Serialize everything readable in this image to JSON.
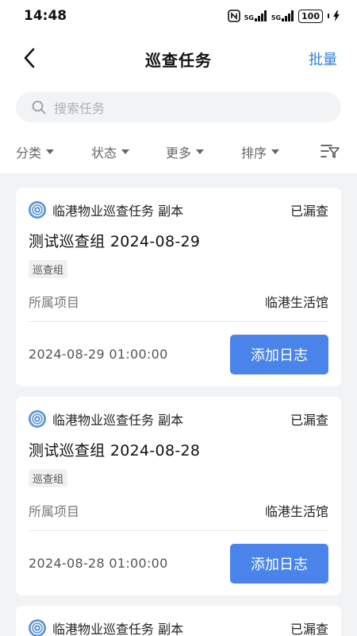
{
  "status_bar": {
    "time": "14:48",
    "signal_1": "5G",
    "signal_2": "5G",
    "battery": "100",
    "icons": [
      "nfc-icon",
      "signal-icon",
      "signal-icon",
      "battery-icon",
      "charging-icon"
    ]
  },
  "header": {
    "title": "巡查任务",
    "batch_label": "批量",
    "accent_color": "#2f7fd9"
  },
  "search": {
    "placeholder": "搜索任务"
  },
  "filters": {
    "items": [
      {
        "label": "分类"
      },
      {
        "label": "状态"
      },
      {
        "label": "更多"
      },
      {
        "label": "排序"
      }
    ]
  },
  "cards": [
    {
      "source": "临港物业巡查任务 副本",
      "status": "已漏查",
      "title": "测试巡查组 2024-08-29",
      "tag": "巡查组",
      "project_label": "所属项目",
      "project_value": "临港生活馆",
      "time": "2024-08-29 01:00:00",
      "action": "添加日志"
    },
    {
      "source": "临港物业巡查任务 副本",
      "status": "已漏查",
      "title": "测试巡查组 2024-08-28",
      "tag": "巡查组",
      "project_label": "所属项目",
      "project_value": "临港生活馆",
      "time": "2024-08-28 01:00:00",
      "action": "添加日志"
    },
    {
      "source": "临港物业巡查任务 副本",
      "status": "已漏查"
    }
  ],
  "colors": {
    "button": "#4a84ea",
    "page_bg": "#f2f3f5"
  }
}
